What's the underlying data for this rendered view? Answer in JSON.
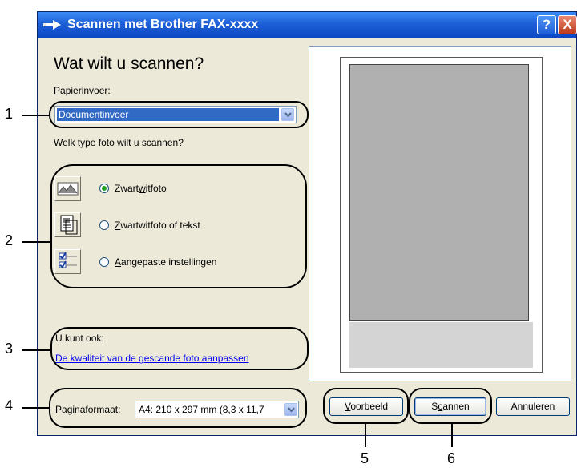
{
  "window": {
    "title": "Scannen met Brother FAX-xxxx",
    "help_label": "?",
    "close_label": "X"
  },
  "dialog": {
    "heading": "Wat wilt u scannen?",
    "paper_source": {
      "label_underlined": "P",
      "label_rest": "apierinvoer:",
      "value": "Documentinvoer"
    },
    "photo_type_prompt": "Welk type foto wilt u scannen?",
    "options": [
      {
        "label_pre": "Zwart",
        "label_u": "w",
        "label_post": "itfoto",
        "selected": true,
        "icon": "photo-icon"
      },
      {
        "label_pre": "",
        "label_u": "Z",
        "label_post": "wartwitfoto of tekst",
        "selected": false,
        "icon": "text-document-icon"
      },
      {
        "label_pre": "",
        "label_u": "A",
        "label_post": "angepaste instellingen",
        "selected": false,
        "icon": "custom-settings-icon"
      }
    ],
    "also_label": "U kunt ook:",
    "quality_link": "De kwaliteit van de gescande foto aanpassen",
    "page_size": {
      "label_pre": "Pa",
      "label_u": "g",
      "label_post": "inaformaat:",
      "value": "A4: 210 x 297 mm (8,3 x 11,7"
    },
    "buttons": {
      "preview": {
        "u": "V",
        "rest": "oorbeeld"
      },
      "scan": {
        "pre": "S",
        "u": "c",
        "rest": "annen"
      },
      "cancel": "Annuleren"
    }
  },
  "callouts": [
    "1",
    "2",
    "3",
    "4",
    "5",
    "6"
  ],
  "colors": {
    "titlebar": "#0b46c4",
    "dialog_bg": "#ece9d8",
    "selected_row": "#316ac5",
    "link": "#0000ee",
    "preview_scan": "#b0b0b0"
  }
}
